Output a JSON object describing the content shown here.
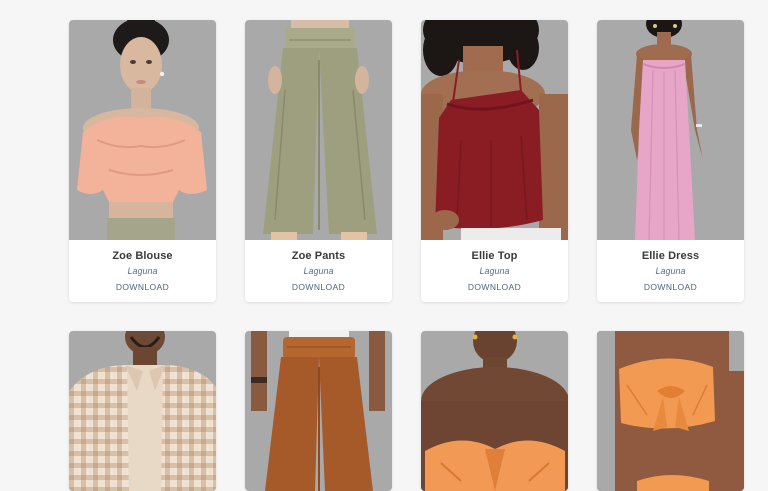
{
  "products": [
    {
      "name": "Zoe Blouse",
      "creator": "Laguna",
      "action": "DOWNLOAD",
      "garment_color": "#f3b29a",
      "image": "woman-in-peach-off-shoulder-blouse"
    },
    {
      "name": "Zoe Pants",
      "creator": "Laguna",
      "action": "DOWNLOAD",
      "garment_color": "#9e9f7f",
      "image": "olive-wide-leg-pants"
    },
    {
      "name": "Ellie Top",
      "creator": "Laguna",
      "action": "DOWNLOAD",
      "garment_color": "#8a1c24",
      "image": "woman-in-red-ruffle-cami"
    },
    {
      "name": "Ellie Dress",
      "creator": "Laguna",
      "action": "DOWNLOAD",
      "garment_color": "#e7a5c8",
      "image": "woman-in-pink-maxi-dress"
    },
    {
      "image": "man-in-plaid-shirt",
      "garment_color": "#e9d6c2"
    },
    {
      "image": "rust-wide-leg-pants",
      "garment_color": "#a65a2a"
    },
    {
      "image": "woman-in-orange-bandeau",
      "garment_color": "#f29a55"
    },
    {
      "image": "woman-in-orange-tie-top",
      "garment_color": "#f39a52"
    }
  ],
  "colors": {
    "page_background": "#f6f6f6",
    "image_background": "#a9a9aa",
    "creator_text": "#5a6f86",
    "download_text": "#4d6680"
  }
}
